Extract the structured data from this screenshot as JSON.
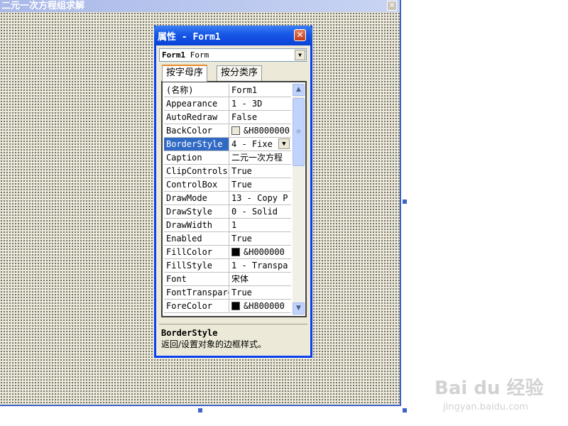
{
  "form": {
    "title": "二元一次方程组求解",
    "close_glyph": "✕"
  },
  "properties": {
    "title": "属性 - Form1",
    "close_glyph": "✕",
    "object_name": "Form1",
    "object_type": "Form",
    "tabs": [
      "按字母序",
      "按分类序"
    ],
    "rows": [
      {
        "name": "(名称)",
        "value": "Form1"
      },
      {
        "name": "Appearance",
        "value": "1 - 3D"
      },
      {
        "name": "AutoRedraw",
        "value": "False"
      },
      {
        "name": "BackColor",
        "value": "&H8000000",
        "swatch": "#ece9d8"
      },
      {
        "name": "BorderStyle",
        "value": "4 - Fixe",
        "selected": true
      },
      {
        "name": "Caption",
        "value": "二元一次方程"
      },
      {
        "name": "ClipControls",
        "value": "True"
      },
      {
        "name": "ControlBox",
        "value": "True"
      },
      {
        "name": "DrawMode",
        "value": "13 - Copy P"
      },
      {
        "name": "DrawStyle",
        "value": "0 - Solid"
      },
      {
        "name": "DrawWidth",
        "value": "1"
      },
      {
        "name": "Enabled",
        "value": "True"
      },
      {
        "name": "FillColor",
        "value": "&H000000",
        "swatch": "#000000"
      },
      {
        "name": "FillStyle",
        "value": "1 - Transpa"
      },
      {
        "name": "Font",
        "value": "宋体"
      },
      {
        "name": "FontTransparent",
        "value": "True"
      },
      {
        "name": "ForeColor",
        "value": "&H800000",
        "swatch": "#000000"
      }
    ],
    "description": {
      "title": "BorderStyle",
      "text": "返回/设置对象的边框样式。"
    }
  },
  "watermark": {
    "brand": "Bai du 经验",
    "url": "jingyan.baidu.com"
  },
  "colors": {
    "selection": "#316ac5",
    "titlebar": "#0841d6",
    "form_background": "#ece9d8"
  }
}
